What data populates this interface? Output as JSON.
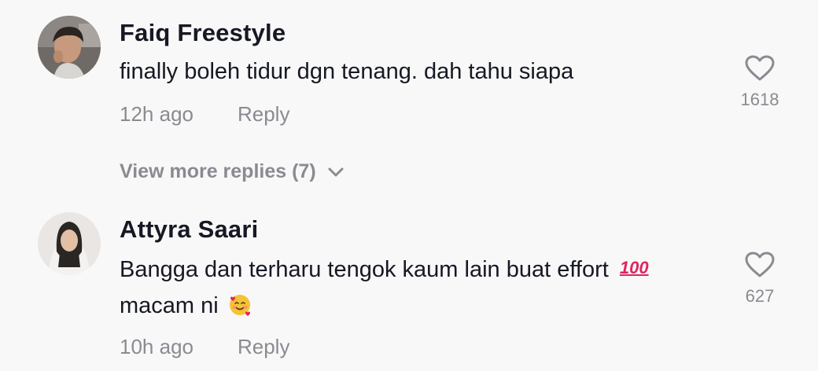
{
  "comments": [
    {
      "username": "Faiq Freestyle",
      "text": "finally boleh tidur dgn tenang. dah tahu siapa",
      "time": "12h ago",
      "reply_label": "Reply",
      "likes": "1618",
      "view_more": "View more replies (7)"
    },
    {
      "username": "Attyra Saari",
      "text_line1": "Bangga dan terharu tengok kaum lain buat effort",
      "emoji1": "💯",
      "text_line2": "macam ni",
      "emoji2": "🥰",
      "time": "10h ago",
      "reply_label": "Reply",
      "likes": "627"
    }
  ],
  "icons": {
    "heart": "heart-outline-icon",
    "chevron": "chevron-down-icon"
  },
  "colors": {
    "background": "#f8f8f8",
    "primary_text": "#161823",
    "secondary_text": "#8a8b91"
  }
}
